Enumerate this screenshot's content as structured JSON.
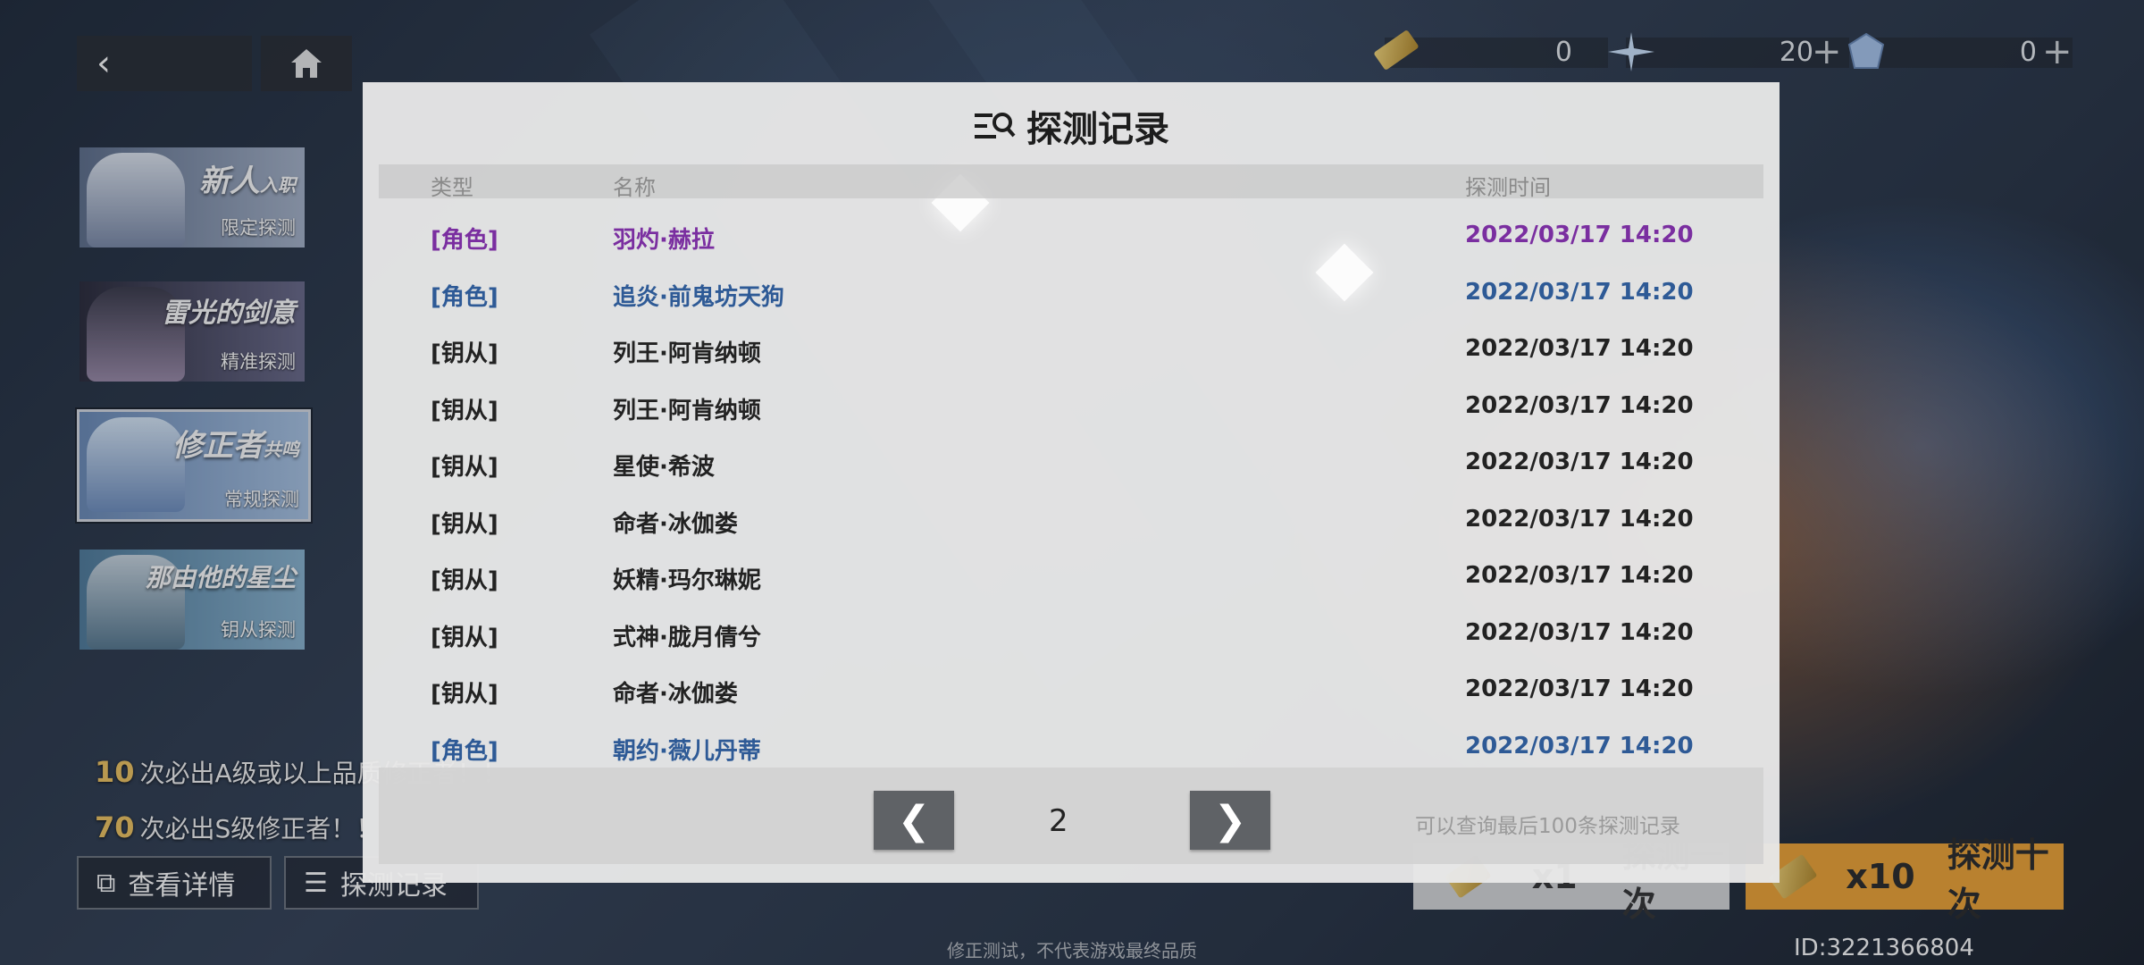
{
  "nav": {
    "back_icon": "‹",
    "home_icon": "⌂"
  },
  "currency": [
    {
      "icon": "ticket-icon",
      "value": "0",
      "has_plus": false
    },
    {
      "icon": "crystal-icon",
      "value": "20",
      "has_plus": true
    },
    {
      "icon": "gem-icon",
      "value": "0",
      "has_plus": true
    }
  ],
  "banners": [
    {
      "title": "新人",
      "title_small": "入职",
      "subtitle": "限定探测",
      "active": false
    },
    {
      "title": "雷光的剑意",
      "title_small": "",
      "subtitle": "精准探测",
      "active": false
    },
    {
      "title": "修正者",
      "title_small": "共鸣",
      "subtitle": "常规探测",
      "active": true
    },
    {
      "title": "那由他的星尘",
      "title_small": "",
      "subtitle": "钥从探测",
      "active": false
    }
  ],
  "guarantees": [
    {
      "count": "10",
      "text": "次必出A级或以上品质修正者！！"
    },
    {
      "count": "70",
      "text": "次必出S级修正者！！"
    }
  ],
  "bottom_buttons": {
    "details": "查看详情",
    "records": "探测记录"
  },
  "draw": {
    "single_count": "x1",
    "single_label": "探测一次",
    "ten_count": "x10",
    "ten_label": "探测十次"
  },
  "footer_note": "修正测试，不代表游戏最终品质",
  "uid": "ID:3221366804",
  "modal": {
    "title": "探测记录",
    "headers": {
      "type": "类型",
      "name": "名称",
      "time": "探测时间"
    },
    "rows": [
      {
        "type": "[角色]",
        "name": "羽灼·赫拉",
        "time": "2022/03/17 14:20",
        "color": "#7a2ea0"
      },
      {
        "type": "[角色]",
        "name": "追炎·前鬼坊天狗",
        "time": "2022/03/17 14:20",
        "color": "#2e5a96"
      },
      {
        "type": "[钥从]",
        "name": "列王·阿肯纳顿",
        "time": "2022/03/17 14:20",
        "color": "#222222"
      },
      {
        "type": "[钥从]",
        "name": "列王·阿肯纳顿",
        "time": "2022/03/17 14:20",
        "color": "#222222"
      },
      {
        "type": "[钥从]",
        "name": "星使·希波",
        "time": "2022/03/17 14:20",
        "color": "#222222"
      },
      {
        "type": "[钥从]",
        "name": "命者·冰伽娄",
        "time": "2022/03/17 14:20",
        "color": "#222222"
      },
      {
        "type": "[钥从]",
        "name": "妖精·玛尔琳妮",
        "time": "2022/03/17 14:20",
        "color": "#222222"
      },
      {
        "type": "[钥从]",
        "name": "式神·胧月倩兮",
        "time": "2022/03/17 14:20",
        "color": "#222222"
      },
      {
        "type": "[钥从]",
        "name": "命者·冰伽娄",
        "time": "2022/03/17 14:20",
        "color": "#222222"
      },
      {
        "type": "[角色]",
        "name": "朝约·薇儿丹蒂",
        "time": "2022/03/17 14:20",
        "color": "#2e5a96"
      }
    ],
    "pager": {
      "prev": "❮",
      "next": "❯",
      "page": "2",
      "note": "可以查询最后100条探测记录"
    }
  }
}
